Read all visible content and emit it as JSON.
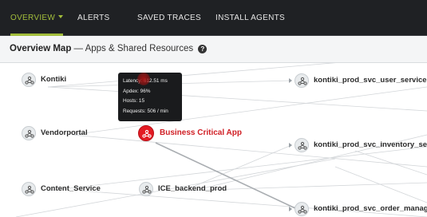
{
  "nav": {
    "tabs": [
      {
        "label": "OVERVIEW",
        "active": true
      },
      {
        "label": "ALERTS",
        "active": false
      },
      {
        "label": "SAVED TRACES",
        "active": false
      },
      {
        "label": "INSTALL AGENTS",
        "active": false
      }
    ]
  },
  "header": {
    "title_bold": "Overview Map",
    "title_rest": " — Apps & Shared Resources",
    "help_glyph": "?"
  },
  "map": {
    "nodes": {
      "kontiki": "Kontiki",
      "vendorportal": "Vendorportal",
      "content_service": "Content_Service",
      "business_critical": "Business Critical App",
      "ice_backend": "ICE_backend_prod",
      "svc_user": "kontiki_prod_svc_user_service",
      "svc_inventory": "kontiki_prod_svc_inventory_se",
      "svc_order": "kontiki_prod_svc_order_manag"
    },
    "tooltip": {
      "latency": "Latency: 612.51 ms",
      "apdex": "Apdex: 96%",
      "hosts": "Hosts: 15",
      "requests": "Requests: 506 / min"
    }
  },
  "colors": {
    "nav_bg": "#1f2124",
    "active_tab": "#a2bd3b",
    "critical": "#e31b23",
    "edge": "#c9cdd1"
  },
  "icons": {
    "app_icon": "network-nodes-icon",
    "help": "question-circle-icon"
  }
}
